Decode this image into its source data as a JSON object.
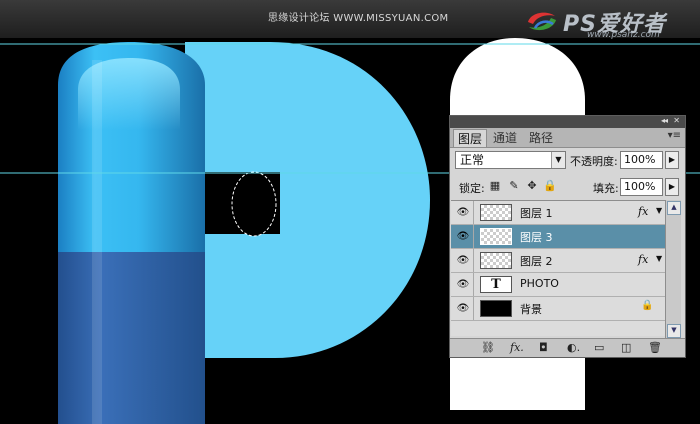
{
  "header": {
    "watermark": "思缘设计论坛 WWW.MISSYUAN.COM",
    "logo_title": "PS爱好者",
    "logo_url": "www.psahz.com"
  },
  "panel": {
    "tabs": [
      {
        "label": "图层"
      },
      {
        "label": "通道"
      },
      {
        "label": "路径"
      }
    ],
    "collapse_icon": "◂◂",
    "close_icon": "✕",
    "menu_icon": "▾≡",
    "blend_mode": "正常",
    "opacity_label": "不透明度:",
    "opacity_value": "100%",
    "lock_label": "锁定:",
    "fill_label": "填充:",
    "fill_value": "100%",
    "layers": [
      {
        "name": "图层 1",
        "fx": "fx",
        "selected": false
      },
      {
        "name": "图层 3",
        "fx": "",
        "selected": true
      },
      {
        "name": "图层 2",
        "fx": "fx",
        "selected": false
      },
      {
        "name": "PHOTO",
        "thumb_text": "T",
        "fx": "",
        "selected": false
      },
      {
        "name": "背景",
        "fx": "",
        "selected": false,
        "locked": true
      }
    ],
    "bottom_icons": [
      "link-icon",
      "fx-icon",
      "mask-icon",
      "adjustment-icon",
      "group-folder-icon",
      "new-layer-icon",
      "trash-icon"
    ]
  },
  "colors": {
    "canvas_bg": "#000000",
    "blue_dark": "#2ea4e0",
    "blue_light": "#66d2f8",
    "band": "#3366aa",
    "guide": "#5fd8e8",
    "selected_layer": "#5a8fa8"
  }
}
